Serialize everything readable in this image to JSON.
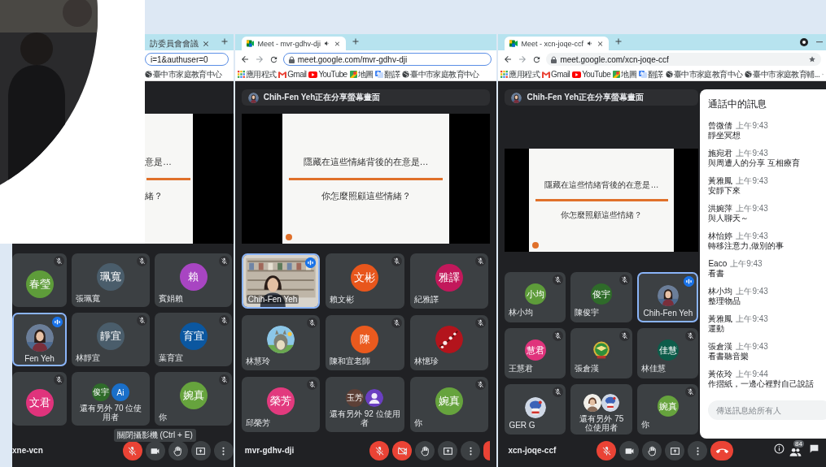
{
  "windows": [
    {
      "tab": {
        "kind": "page",
        "title": "訪委員會會議",
        "audio": false,
        "selected": false
      },
      "address": {
        "url": "i=1&authuser=0",
        "focused": true
      },
      "bookmarks": [
        {
          "kind": "globe",
          "label": "臺中市家庭教育中心"
        }
      ],
      "slide": {
        "lines": [
          "意是…",
          "緒？"
        ]
      },
      "tiles": [
        {
          "kind": "avatar",
          "avatar": {
            "kind": "initials",
            "text": "春瑩",
            "color": "#5e9c3a"
          },
          "speaking": false
        },
        {
          "kind": "avatar",
          "name": "張珮寬",
          "avatar": {
            "kind": "initials",
            "text": "珮寬",
            "color": "#4a5d6b"
          },
          "speaking": false
        },
        {
          "kind": "avatar",
          "name": "賓娟賴",
          "avatar": {
            "kind": "initials",
            "text": "賴",
            "color": "#a845c2"
          },
          "speaking": false
        },
        {
          "kind": "avatar",
          "name": "Fen Yeh",
          "speaking": true
        },
        {
          "kind": "avatar",
          "name": "林靜宜",
          "avatar": {
            "kind": "initials",
            "text": "靜宜",
            "color": "#4a5d6b"
          },
          "speaking": false
        },
        {
          "kind": "avatar",
          "name": "葉育宜",
          "avatar": {
            "kind": "initials",
            "text": "育宜",
            "color": "#0b57a0"
          },
          "speaking": false
        },
        {
          "kind": "avatar",
          "avatar": {
            "kind": "initials",
            "text": "文君",
            "color": "#e0337c"
          },
          "speaking": false
        },
        {
          "kind": "others",
          "name": "還有另外 70 位使用者",
          "avatars": [
            {
              "kind": "initials",
              "text": "俊宇",
              "color": "#2f6b2a"
            },
            {
              "kind": "initials",
              "text": "Ai",
              "color": "#1a6fc9"
            }
          ]
        },
        {
          "kind": "avatar",
          "name": "你",
          "avatar": {
            "kind": "initials",
            "text": "婉真",
            "color": "#66a33d"
          },
          "speaking": false
        }
      ],
      "meeting_code": "xne-vcn",
      "tooltip": "關閉攝影機 (Ctrl + E)",
      "controls": [
        {
          "kind": "mic",
          "on": false
        },
        {
          "kind": "camera",
          "on": true
        },
        {
          "kind": "hand"
        },
        {
          "kind": "present"
        },
        {
          "kind": "more"
        }
      ]
    },
    {
      "tab": {
        "kind": "meet",
        "title": "Meet - mvr-gdhv-dji",
        "audio": true,
        "selected": true
      },
      "address": {
        "url": "meet.google.com/mvr-gdhv-dji",
        "focused": true
      },
      "bookmarks": [
        {
          "kind": "apps",
          "label": "應用程式"
        },
        {
          "kind": "gmail",
          "label": "Gmail"
        },
        {
          "kind": "youtube",
          "label": "YouTube"
        },
        {
          "kind": "maps",
          "label": "地圖"
        },
        {
          "kind": "translate",
          "label": "翻譯"
        },
        {
          "kind": "globe",
          "label": "臺中市家庭教育中心"
        }
      ],
      "banner": "Chih-Fen Yeh正在分享螢幕畫面",
      "slide": {
        "lines": [
          "隱藏在這些情緒背後的在意是…",
          "你怎麼照顧這些情緒？"
        ]
      },
      "tiles": [
        {
          "kind": "video",
          "name": "Chih-Fen Yeh",
          "speaking": true
        },
        {
          "kind": "avatar",
          "name": "賴文彬",
          "avatar": {
            "kind": "initials",
            "text": "文彬",
            "color": "#e8561c"
          },
          "speaking": false
        },
        {
          "kind": "avatar",
          "name": "紀雅譯",
          "avatar": {
            "kind": "initials",
            "text": "雅譯",
            "color": "#c2185b"
          },
          "speaking": false
        },
        {
          "kind": "avatar",
          "name": "林慧玲",
          "speaking": false
        },
        {
          "kind": "avatar",
          "name": "陳和宜老師",
          "avatar": {
            "kind": "initials",
            "text": "陳",
            "color": "#ea5a1e"
          },
          "speaking": false
        },
        {
          "kind": "avatar",
          "name": "林憶珍",
          "speaking": false
        },
        {
          "kind": "avatar",
          "name": "邱榮芳",
          "avatar": {
            "kind": "initials",
            "text": "榮芳",
            "color": "#e23a7e"
          },
          "speaking": false
        },
        {
          "kind": "others",
          "name": "還有另外 92 位使用者",
          "avatars": [
            {
              "kind": "initials",
              "text": "玉芳",
              "color": "#5d4037"
            },
            {
              "kind": "person",
              "color": "#6a3fc1"
            }
          ]
        },
        {
          "kind": "avatar",
          "name": "你",
          "avatar": {
            "kind": "initials",
            "text": "婉真",
            "color": "#66a33d"
          },
          "speaking": false
        }
      ],
      "meeting_code": "mvr-gdhv-dji",
      "controls": [
        {
          "kind": "mic",
          "on": false
        },
        {
          "kind": "camera",
          "on": false
        },
        {
          "kind": "hand"
        },
        {
          "kind": "present"
        },
        {
          "kind": "more"
        },
        {
          "kind": "end"
        }
      ]
    },
    {
      "tab": {
        "kind": "meet",
        "title": "Meet - xcn-joqe-ccf",
        "audio": true,
        "selected": true
      },
      "address": {
        "url": "meet.google.com/xcn-joqe-ccf",
        "focused": false
      },
      "bookmarks": [
        {
          "kind": "apps",
          "label": "應用程式"
        },
        {
          "kind": "gmail",
          "label": "Gmail"
        },
        {
          "kind": "youtube",
          "label": "YouTube"
        },
        {
          "kind": "maps",
          "label": "地圖"
        },
        {
          "kind": "translate",
          "label": "翻譯"
        },
        {
          "kind": "globe",
          "label": "臺中市家庭教育中心"
        },
        {
          "kind": "globe",
          "label": "臺中市家庭教育輔..."
        }
      ],
      "banner": "Chih-Fen Yeh正在分享螢幕畫面",
      "slide": {
        "lines": [
          "隱藏在這些情緒背後的在意是…",
          "你怎麼照顧這些情緒？"
        ]
      },
      "tiles": [
        {
          "kind": "avatar",
          "name": "林小均",
          "avatar": {
            "kind": "initials",
            "text": "小均",
            "color": "#5e9c3a"
          },
          "speaking": false
        },
        {
          "kind": "avatar",
          "name": "陳俊宇",
          "avatar": {
            "kind": "initials",
            "text": "俊宇",
            "color": "#2f6b2a"
          },
          "speaking": false
        },
        {
          "kind": "avatar",
          "name": "Chih-Fen Yeh",
          "speaking": true
        },
        {
          "kind": "avatar",
          "name": "王慧君",
          "avatar": {
            "kind": "initials",
            "text": "慧君",
            "color": "#e0337c"
          },
          "speaking": false
        },
        {
          "kind": "avatar",
          "name": "張倉漢",
          "speaking": false
        },
        {
          "kind": "avatar",
          "name": "林佳慧",
          "avatar": {
            "kind": "initials",
            "text": "佳慧",
            "color": "#0d5c4a"
          },
          "speaking": false
        },
        {
          "kind": "avatar",
          "name": "GER G",
          "speaking": false
        },
        {
          "kind": "others",
          "name": "還有另外 75 位使用者"
        },
        {
          "kind": "avatar",
          "name": "你",
          "avatar": {
            "kind": "initials",
            "text": "婉真",
            "color": "#66a33d"
          },
          "speaking": false
        }
      ],
      "meeting_code": "xcn-joqe-ccf",
      "controls": [
        {
          "kind": "mic",
          "on": false
        },
        {
          "kind": "camera",
          "on": true
        },
        {
          "kind": "hand"
        },
        {
          "kind": "present"
        },
        {
          "kind": "more"
        },
        {
          "kind": "end"
        }
      ],
      "side_controls": [
        {
          "kind": "info"
        },
        {
          "kind": "people",
          "badge": "84"
        },
        {
          "kind": "chat"
        }
      ],
      "chat": {
        "title": "通話中的訊息",
        "placeholder": "傳送訊息給所有人",
        "messages": [
          {
            "sender": "曾微倩",
            "time": "上午9:43",
            "text": "靜坐冥想"
          },
          {
            "sender": "施宛君",
            "time": "上午9:43",
            "text": "與周遭人的分享 互相療育"
          },
          {
            "sender": "黃雅鳳",
            "time": "上午9:43",
            "text": "安靜下來"
          },
          {
            "sender": "洪婉萍",
            "time": "上午9:43",
            "text": "與人聊天～"
          },
          {
            "sender": "林怡婷",
            "time": "上午9:43",
            "text": "轉移注意力,做別的事"
          },
          {
            "sender": "Eaco",
            "time": "上午9:43",
            "text": "看書"
          },
          {
            "sender": "林小均",
            "time": "上午9:43",
            "text": "整理物品"
          },
          {
            "sender": "黃雅鳳",
            "time": "上午9:43",
            "text": "運動"
          },
          {
            "sender": "張倉漢",
            "time": "上午9:43",
            "text": "看書聽音樂"
          },
          {
            "sender": "黃依玲",
            "time": "上午9:44",
            "text": "作摺紙，一邊心裡對自己說話"
          }
        ]
      }
    }
  ]
}
